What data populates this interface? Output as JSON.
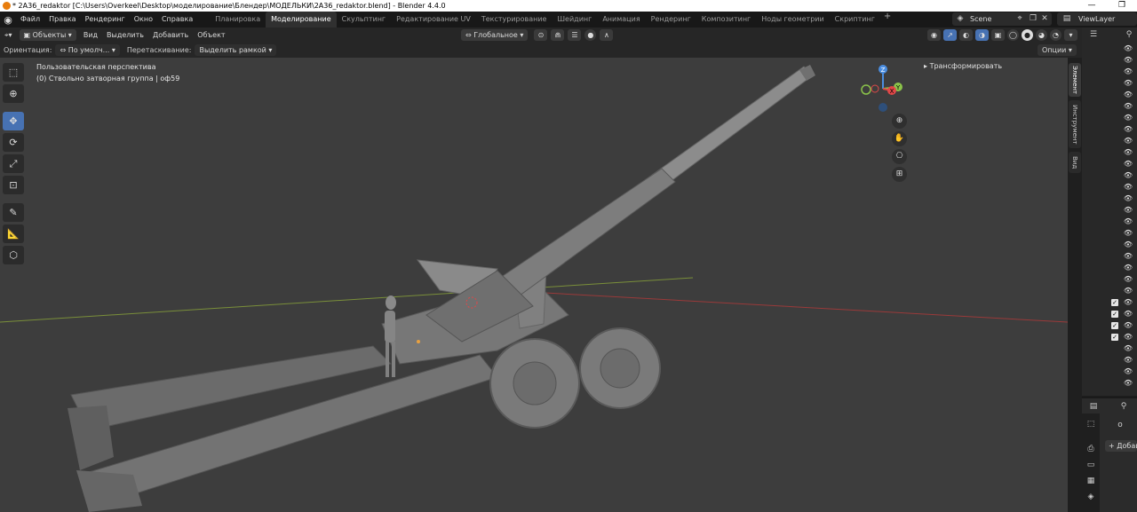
{
  "window": {
    "title": "* 2A36_redaktor [C:\\Users\\Overkeel\\Desktop\\моделирование\\Блендер\\МОДЕЛЬКИ\\2A36_redaktor.blend] - Blender 4.4.0",
    "minimize": "—",
    "maximize": "❐"
  },
  "menu": {
    "items": [
      "Файл",
      "Правка",
      "Рендеринг",
      "Окно",
      "Справка"
    ]
  },
  "workspaces": {
    "tabs": [
      "Планировка",
      "Моделирование",
      "Скульптинг",
      "Редактирование UV",
      "Текстурирование",
      "Шейдинг",
      "Анимация",
      "Рендеринг",
      "Композитинг",
      "Ноды геометрии",
      "Скриптинг"
    ],
    "active": "Моделирование",
    "add": "+"
  },
  "scene": {
    "name": "Scene"
  },
  "view_layer": {
    "name": "ViewLayer"
  },
  "header": {
    "mode": "Объекты",
    "view": "Вид",
    "select": "Выделить",
    "add": "Добавить",
    "object": "Объект",
    "transform_orientation": "Глобальное"
  },
  "tool_settings": {
    "orientation_label": "Ориентация:",
    "orientation_value": "По умолч...",
    "drag_label": "Перетаскивание:",
    "drag_value": "Выделить рамкой",
    "options": "Опции"
  },
  "viewport": {
    "perspective": "Пользовательская перспектива",
    "active_object": "(0) Ствольно затворная группа | оф59"
  },
  "gizmo": {
    "z": "Z",
    "y": "Y",
    "x": "X"
  },
  "npanel": {
    "section": "Трансформировать",
    "tabs": [
      "Элемент",
      "Инструмент",
      "Вид"
    ]
  },
  "properties": {
    "add_button": "+ Добав"
  },
  "colors": {
    "accent": "#4772b3",
    "viewport_bg": "#3d3d3d",
    "x_axis": "#e04848",
    "y_axis": "#8bc34a",
    "z_axis": "#4a8de0"
  }
}
